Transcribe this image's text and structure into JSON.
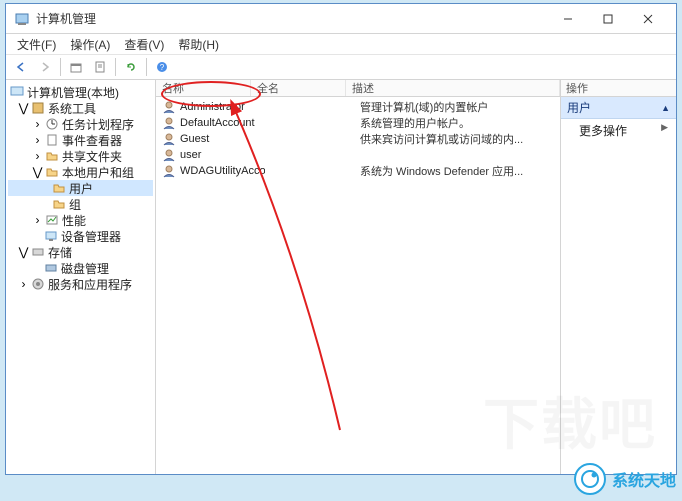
{
  "window": {
    "title": "计算机管理"
  },
  "menu": {
    "file": "文件(F)",
    "action": "操作(A)",
    "view": "查看(V)",
    "help": "帮助(H)"
  },
  "tree": {
    "root": "计算机管理(本地)",
    "systools": "系统工具",
    "scheduler": "任务计划程序",
    "eventviewer": "事件查看器",
    "sharedfolders": "共享文件夹",
    "localusers": "本地用户和组",
    "users": "用户",
    "groups": "组",
    "perf": "性能",
    "devmgr": "设备管理器",
    "storage": "存储",
    "diskmgmt": "磁盘管理",
    "services": "服务和应用程序"
  },
  "columns": {
    "name": "名称",
    "fullname": "全名",
    "description": "描述"
  },
  "users": [
    {
      "name": "Administrator",
      "fullname": "",
      "desc": "管理计算机(域)的内置帐户"
    },
    {
      "name": "DefaultAccount",
      "fullname": "",
      "desc": "系统管理的用户帐户。"
    },
    {
      "name": "Guest",
      "fullname": "",
      "desc": "供来宾访问计算机或访问域的内..."
    },
    {
      "name": "user",
      "fullname": "",
      "desc": ""
    },
    {
      "name": "WDAGUtilityAccount",
      "fullname": "",
      "desc": "系统为 Windows Defender 应用..."
    }
  ],
  "actions": {
    "header": "操作",
    "selected": "用户",
    "more": "更多操作"
  },
  "watermark": {
    "text": "系统天地",
    "bg": "下载吧"
  }
}
